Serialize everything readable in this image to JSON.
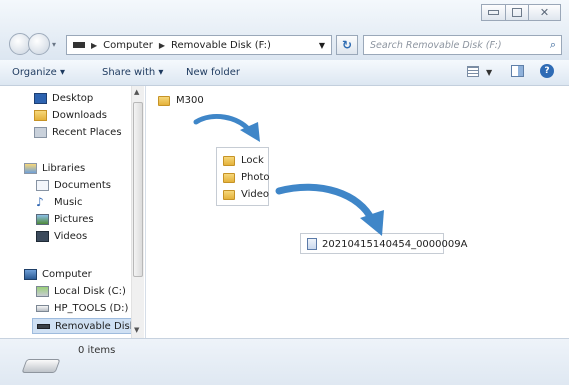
{
  "address": {
    "crumbs": [
      "Computer",
      "Removable Disk (F:)"
    ],
    "search_placeholder": "Search Removable Disk (F:)"
  },
  "toolbar": {
    "organize": "Organize ▾",
    "share": "Share with ▾",
    "new_folder": "New folder"
  },
  "nav": {
    "items": [
      {
        "label": "Desktop",
        "icon": "desktop-icon"
      },
      {
        "label": "Downloads",
        "icon": "downloads-icon"
      },
      {
        "label": "Recent Places",
        "icon": "recent-places-icon"
      },
      {
        "label": "Libraries",
        "icon": "libraries-icon"
      },
      {
        "label": "Documents",
        "icon": "documents-icon"
      },
      {
        "label": "Music",
        "icon": "music-icon"
      },
      {
        "label": "Pictures",
        "icon": "pictures-icon"
      },
      {
        "label": "Videos",
        "icon": "videos-icon"
      },
      {
        "label": "Computer",
        "icon": "computer-icon"
      },
      {
        "label": "Local Disk (C:)",
        "icon": "local-disk-icon"
      },
      {
        "label": "HP_TOOLS (D:)",
        "icon": "drive-icon"
      },
      {
        "label": "Removable Disk (",
        "icon": "removable-disk-icon"
      }
    ]
  },
  "content": {
    "root_folder": "M300",
    "subfolders": [
      "Lock",
      "Photo",
      "Video"
    ],
    "file": "20210415140454_0000009A"
  },
  "status": {
    "items_count": "0 items"
  },
  "colors": {
    "arrow": "#3f86c8",
    "folder": "#e8b94a",
    "selection": "#cfe0f3"
  }
}
